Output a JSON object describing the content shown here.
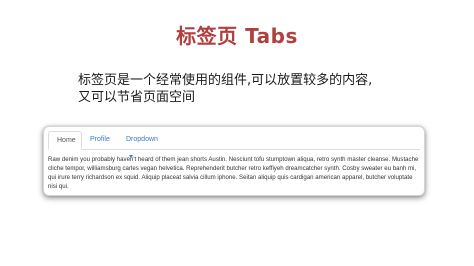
{
  "slide": {
    "title": "标签页 Tabs",
    "description_line1": "标签页是一个经常使用的组件,可以放置较多的内容,",
    "description_line2": "又可以节省页面空间"
  },
  "tabs": {
    "items": [
      {
        "label": "Home",
        "active": true
      },
      {
        "label": "Profile",
        "active": false
      },
      {
        "label": "Dropdown",
        "active": false
      }
    ],
    "content": "Raw denim you probably haven't heard of them jean shorts Austin. Nesciunt tofu stumptown aliqua, retro synth master cleanse. Mustache cliche tempor, williamsburg carles vegan helvetica. Reprehenderit butcher retro keffiyeh dreamcatcher synth. Cosby sweater eu banh mi, qui irure terry richardson ex squid. Aliquip placeat salvia cillum iphone. Seitan aliquip quis cardigan american apparel, butcher voluptate nisi qui."
  },
  "colors": {
    "title": "#b0403f",
    "link": "#3a7bc8",
    "active_tab_text": "#555555",
    "body_text": "#333333"
  },
  "icons": {
    "dropdown_caret": "caret-down-icon"
  }
}
